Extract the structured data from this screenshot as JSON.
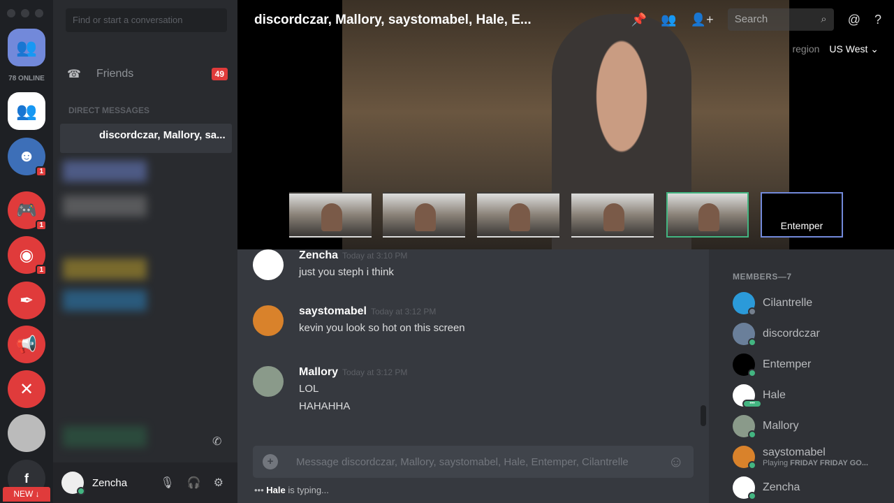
{
  "servers": {
    "online_count": "78 ONLINE",
    "badges": [
      "1",
      "1",
      "1"
    ],
    "new_label": "NEW",
    "facebook_glyph": "f"
  },
  "dm": {
    "search_placeholder": "Find or start a conversation",
    "friends_label": "Friends",
    "friends_count": "49",
    "section_header": "DIRECT MESSAGES",
    "selected_dm": "discordczar, Mallory, sa...",
    "user": {
      "name": "Zencha"
    }
  },
  "call": {
    "title": "discordczar, Mallory, saystomabel, Hale, E...",
    "search_placeholder": "Search",
    "region_label": "region",
    "region_value": "US West",
    "thumb_label": "Entemper"
  },
  "messages": [
    {
      "author": "Zencha",
      "time": "Today at 3:10 PM",
      "lines": [
        "just you steph i think"
      ],
      "avatar_color": "#ffffff"
    },
    {
      "author": "saystomabel",
      "time": "Today at 3:12 PM",
      "lines": [
        "kevin you look so hot on this screen"
      ],
      "avatar_color": "#d9822b"
    },
    {
      "author": "Mallory",
      "time": "Today at 3:12 PM",
      "lines": [
        "LOL",
        "HAHAHHA"
      ],
      "avatar_color": "#8a9a8a"
    }
  ],
  "composer": {
    "placeholder": "Message discordczar, Mallory, saystomabel, Hale, Entemper, Cilantrelle",
    "typing_user": "Hale",
    "typing_suffix": " is typing..."
  },
  "members": {
    "header": "MEMBERS—7",
    "list": [
      {
        "name": "Cilantrelle",
        "status": "idle"
      },
      {
        "name": "discordczar",
        "status": "online"
      },
      {
        "name": "Entemper",
        "status": "online"
      },
      {
        "name": "Hale",
        "status": "typing"
      },
      {
        "name": "Mallory",
        "status": "online"
      },
      {
        "name": "saystomabel",
        "status": "online",
        "activity_prefix": "Playing ",
        "activity": "FRIDAY FRIDAY GO..."
      },
      {
        "name": "Zencha",
        "status": "online"
      }
    ]
  },
  "colors": {
    "accent": "#7289da",
    "danger": "#e03b3b",
    "online": "#43b581"
  }
}
